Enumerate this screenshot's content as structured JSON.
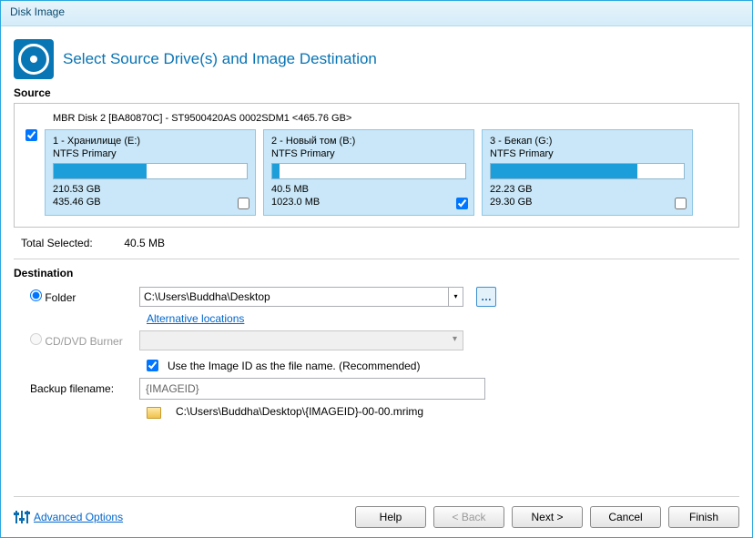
{
  "window": {
    "title": "Disk Image"
  },
  "header": {
    "title": "Select Source Drive(s) and Image Destination"
  },
  "source": {
    "label": "Source",
    "disk_label": "MBR Disk 2 [BA80870C] - ST9500420AS 0002SDM1  <465.76 GB>",
    "disk_checked": true,
    "partitions": [
      {
        "title": "1 - Хранилище (E:)",
        "type": "NTFS Primary",
        "used": "210.53 GB",
        "total": "435.46 GB",
        "fill_pct": 48,
        "checked": false
      },
      {
        "title": "2 - Новый том (B:)",
        "type": "NTFS Primary",
        "used": "40.5 MB",
        "total": "1023.0 MB",
        "fill_pct": 4,
        "checked": true
      },
      {
        "title": "3 - Бекап (G:)",
        "type": "NTFS Primary",
        "used": "22.23 GB",
        "total": "29.30 GB",
        "fill_pct": 76,
        "checked": false
      }
    ],
    "total_label": "Total Selected:",
    "total_value": "40.5 MB"
  },
  "destination": {
    "label": "Destination",
    "folder_label": "Folder",
    "folder_value": "C:\\Users\\Buddha\\Desktop",
    "alt_link": "Alternative locations",
    "burner_label": "CD/DVD Burner",
    "use_imageid_label": "Use the Image ID as the file name.  (Recommended)",
    "use_imageid_checked": true,
    "filename_label": "Backup filename:",
    "filename_value": "{IMAGEID}",
    "output_path": "C:\\Users\\Buddha\\Desktop\\{IMAGEID}-00-00.mrimg"
  },
  "footer": {
    "advanced": "Advanced Options",
    "help": "Help",
    "back": "< Back",
    "next": "Next >",
    "cancel": "Cancel",
    "finish": "Finish"
  }
}
